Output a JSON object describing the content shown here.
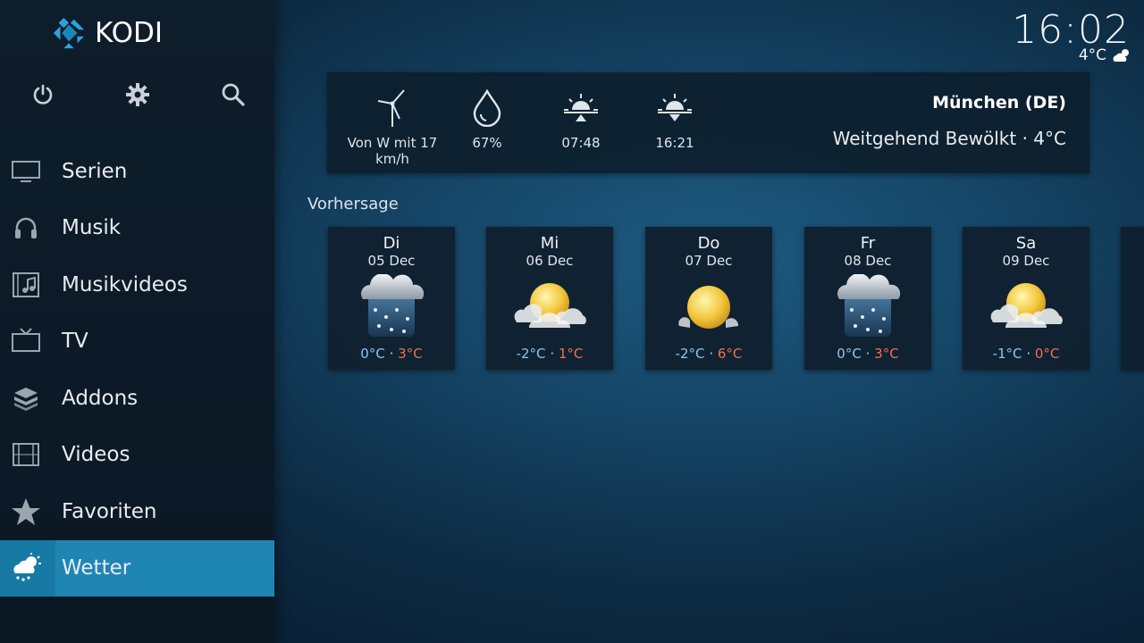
{
  "app": {
    "logo_text": "KODI"
  },
  "clock": {
    "time": "16:02",
    "temp": "4°C"
  },
  "top_icons": [
    "power-icon",
    "gear-icon",
    "search-icon"
  ],
  "menu": [
    {
      "label": "Serien",
      "icon": "tv-monitor-icon"
    },
    {
      "label": "Musik",
      "icon": "headphones-icon"
    },
    {
      "label": "Musikvideos",
      "icon": "music-video-icon"
    },
    {
      "label": "TV",
      "icon": "tv-icon"
    },
    {
      "label": "Addons",
      "icon": "addons-box-icon"
    },
    {
      "label": "Videos",
      "icon": "film-strip-icon"
    },
    {
      "label": "Favoriten",
      "icon": "star-icon"
    },
    {
      "label": "Wetter",
      "icon": "weather-icon",
      "active": true
    }
  ],
  "current": {
    "wind": "Von W mit 17 km/h",
    "humidity": "67%",
    "sunrise": "07:48",
    "sunset": "16:21",
    "location": "München (DE)",
    "condition": "Weitgehend Bewölkt · 4°C"
  },
  "forecast_title": "Vorhersage",
  "forecast": [
    {
      "day": "Di",
      "date": "05 Dec",
      "low": "0°C",
      "high": "3°C",
      "icon": "snow-cloud-icon"
    },
    {
      "day": "Mi",
      "date": "06 Dec",
      "low": "-2°C",
      "high": "1°C",
      "icon": "partly-sunny-icon"
    },
    {
      "day": "Do",
      "date": "07 Dec",
      "low": "-2°C",
      "high": "6°C",
      "icon": "sunny-icon"
    },
    {
      "day": "Fr",
      "date": "08 Dec",
      "low": "0°C",
      "high": "3°C",
      "icon": "snow-cloud-icon"
    },
    {
      "day": "Sa",
      "date": "09 Dec",
      "low": "-1°C",
      "high": "0°C",
      "icon": "partly-sunny-icon"
    }
  ],
  "separator": "·",
  "colors": {
    "accent": "#1f86b4",
    "temp_low": "#8fc4ef",
    "temp_high": "#ee7052"
  }
}
